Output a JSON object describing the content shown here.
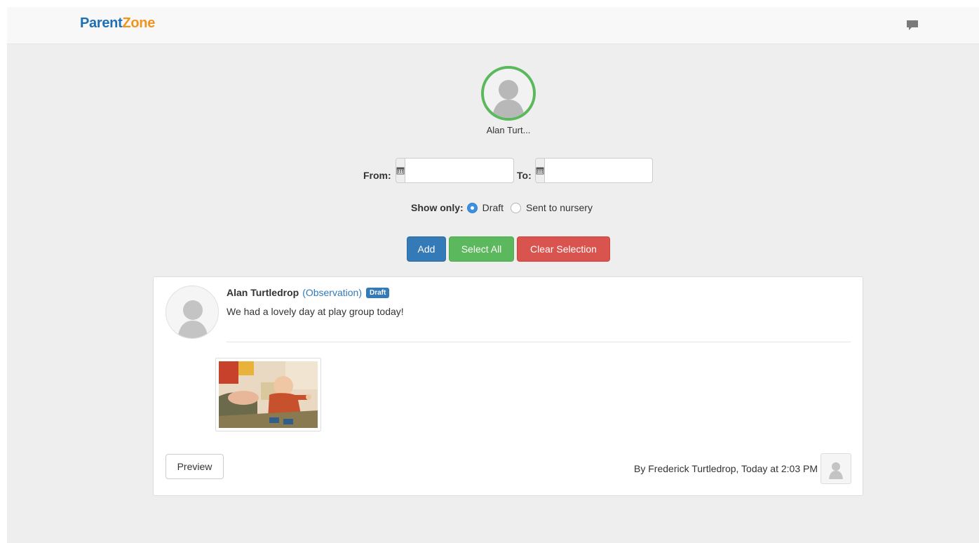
{
  "brand": {
    "part1": "Parent",
    "part2": "Zone"
  },
  "nav": {
    "chat_icon": "chat-bubble-icon"
  },
  "child_selector": {
    "name": "Alan Turt..."
  },
  "filters": {
    "from_label": "From:",
    "to_label": "To:",
    "from_value": "",
    "to_value": "",
    "show_only_label": "Show only:",
    "options": [
      "Draft",
      "Sent to nursery"
    ],
    "selected": "Draft"
  },
  "actions": {
    "add_label": "Add",
    "select_all_label": "Select All",
    "clear_label": "Clear Selection"
  },
  "post": {
    "author": "Alan Turtledrop",
    "type": "(Observation)",
    "status": "Draft",
    "text": "We had a lovely day at play group today!",
    "preview_label": "Preview",
    "byline": "By Frederick Turtledrop, Today at 2:03 PM"
  },
  "colors": {
    "primary": "#337ab7",
    "success": "#5cb85c",
    "danger": "#d9534f",
    "brand_blue": "#1f6fb5",
    "brand_orange": "#f0931f"
  }
}
